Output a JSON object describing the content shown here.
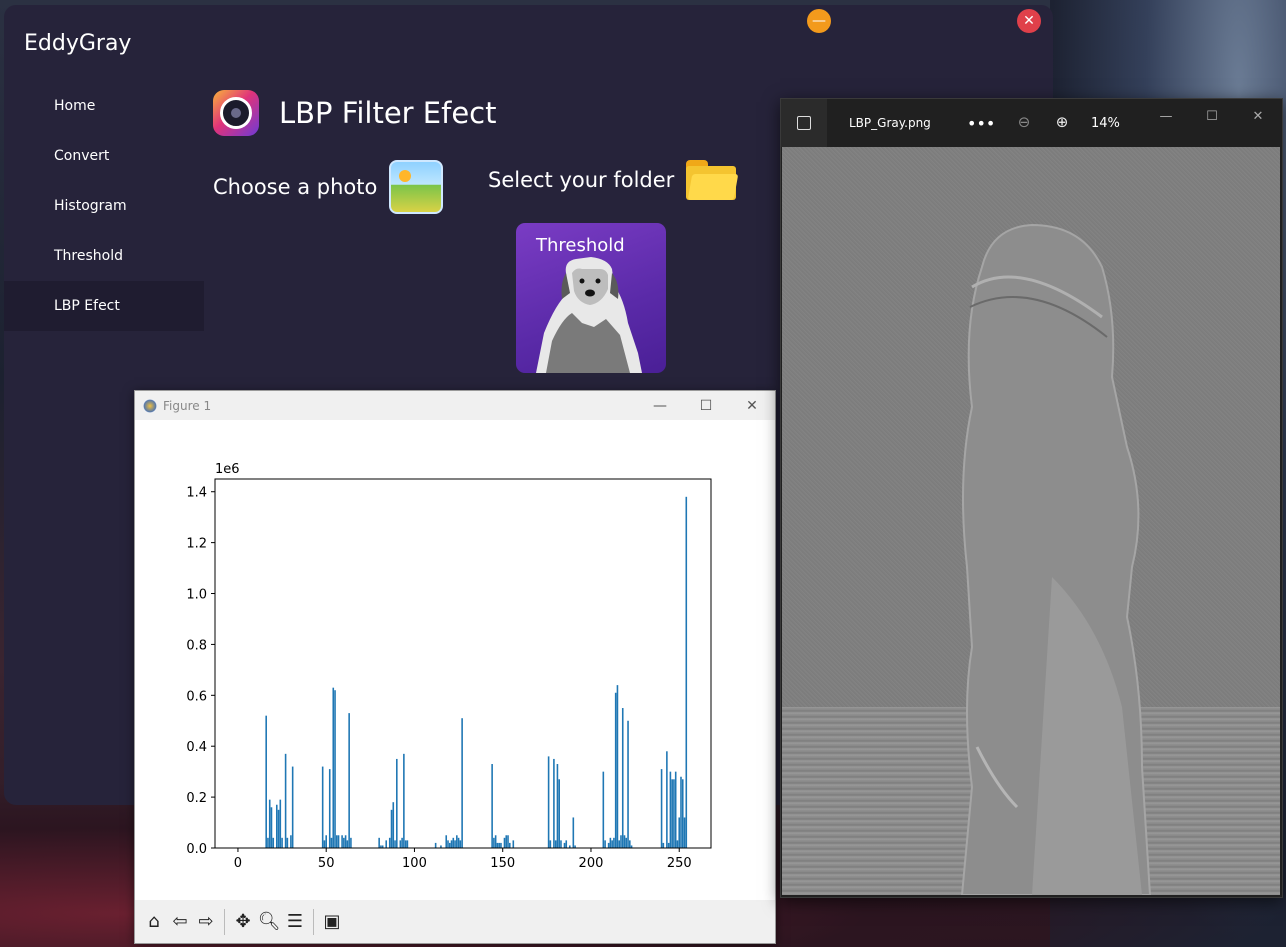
{
  "app": {
    "title": "EddyGray",
    "nav": [
      {
        "label": "Home"
      },
      {
        "label": "Convert"
      },
      {
        "label": "Histogram"
      },
      {
        "label": "Threshold"
      },
      {
        "label": "LBP Efect"
      }
    ],
    "active_nav": "LBP Efect",
    "header_title": "LBP Filter Efect",
    "choose_photo_label": "Choose a photo",
    "select_folder_label": "Select your folder",
    "thumbnail_label": "Threshold",
    "colors": {
      "minimize": "#f39a1c",
      "close": "#e0404a",
      "background": "#26233a"
    }
  },
  "figure": {
    "window_title": "Figure 1",
    "toolbar_icons": [
      "home-icon",
      "back-icon",
      "forward-icon",
      "pan-icon",
      "zoom-icon",
      "configure-subplots-icon",
      "save-icon"
    ]
  },
  "viewer": {
    "file_name": "LBP_Gray.png",
    "more_label": "•••",
    "zoom_level": "14%"
  },
  "chart_data": {
    "type": "bar",
    "title": "",
    "xlabel": "",
    "ylabel": "",
    "offset_label": "1e6",
    "xlim": [
      -13,
      268
    ],
    "ylim": [
      0,
      1.45
    ],
    "x_ticks": [
      0,
      50,
      100,
      150,
      200,
      250
    ],
    "x_tick_labels": [
      "0",
      "50",
      "100",
      "150",
      "200",
      "250"
    ],
    "y_ticks": [
      0.0,
      0.2,
      0.4,
      0.6,
      0.8,
      1.0,
      1.2,
      1.4
    ],
    "y_tick_labels": [
      "0.0",
      "0.2",
      "0.4",
      "0.6",
      "0.8",
      "1.0",
      "1.2",
      "1.4"
    ],
    "color": "#1f77b4",
    "x": [
      16,
      17,
      18,
      19,
      20,
      22,
      23,
      24,
      25,
      27,
      28,
      30,
      31,
      48,
      49,
      50,
      52,
      53,
      54,
      55,
      56,
      57,
      59,
      60,
      61,
      62,
      63,
      64,
      80,
      81,
      82,
      84,
      86,
      87,
      88,
      89,
      90,
      92,
      93,
      94,
      95,
      96,
      112,
      115,
      118,
      119,
      120,
      121,
      122,
      123,
      124,
      125,
      126,
      127,
      144,
      145,
      146,
      147,
      148,
      149,
      151,
      152,
      153,
      154,
      156,
      176,
      177,
      179,
      180,
      181,
      182,
      183,
      185,
      186,
      188,
      190,
      191,
      207,
      208,
      210,
      211,
      212,
      213,
      214,
      215,
      216,
      217,
      218,
      219,
      220,
      221,
      222,
      223,
      240,
      241,
      243,
      244,
      245,
      246,
      247,
      248,
      249,
      250,
      251,
      252,
      253,
      254,
      255
    ],
    "values": [
      0.52,
      0.04,
      0.19,
      0.16,
      0.04,
      0.17,
      0.15,
      0.19,
      0.04,
      0.37,
      0.04,
      0.05,
      0.32,
      0.32,
      0.03,
      0.05,
      0.31,
      0.04,
      0.63,
      0.62,
      0.05,
      0.05,
      0.05,
      0.04,
      0.05,
      0.03,
      0.53,
      0.04,
      0.04,
      0.01,
      0.01,
      0.03,
      0.04,
      0.15,
      0.18,
      0.03,
      0.35,
      0.03,
      0.04,
      0.37,
      0.03,
      0.03,
      0.02,
      0.01,
      0.05,
      0.03,
      0.02,
      0.03,
      0.04,
      0.03,
      0.05,
      0.04,
      0.03,
      0.51,
      0.33,
      0.04,
      0.05,
      0.02,
      0.02,
      0.02,
      0.04,
      0.05,
      0.05,
      0.02,
      0.03,
      0.36,
      0.03,
      0.35,
      0.03,
      0.33,
      0.27,
      0.03,
      0.02,
      0.03,
      0.01,
      0.12,
      0.01,
      0.3,
      0.03,
      0.02,
      0.04,
      0.03,
      0.04,
      0.61,
      0.64,
      0.03,
      0.05,
      0.55,
      0.05,
      0.04,
      0.5,
      0.03,
      0.01,
      0.31,
      0.02,
      0.38,
      0.02,
      0.3,
      0.27,
      0.27,
      0.3,
      0.03,
      0.12,
      0.28,
      0.27,
      0.12,
      1.38
    ]
  }
}
